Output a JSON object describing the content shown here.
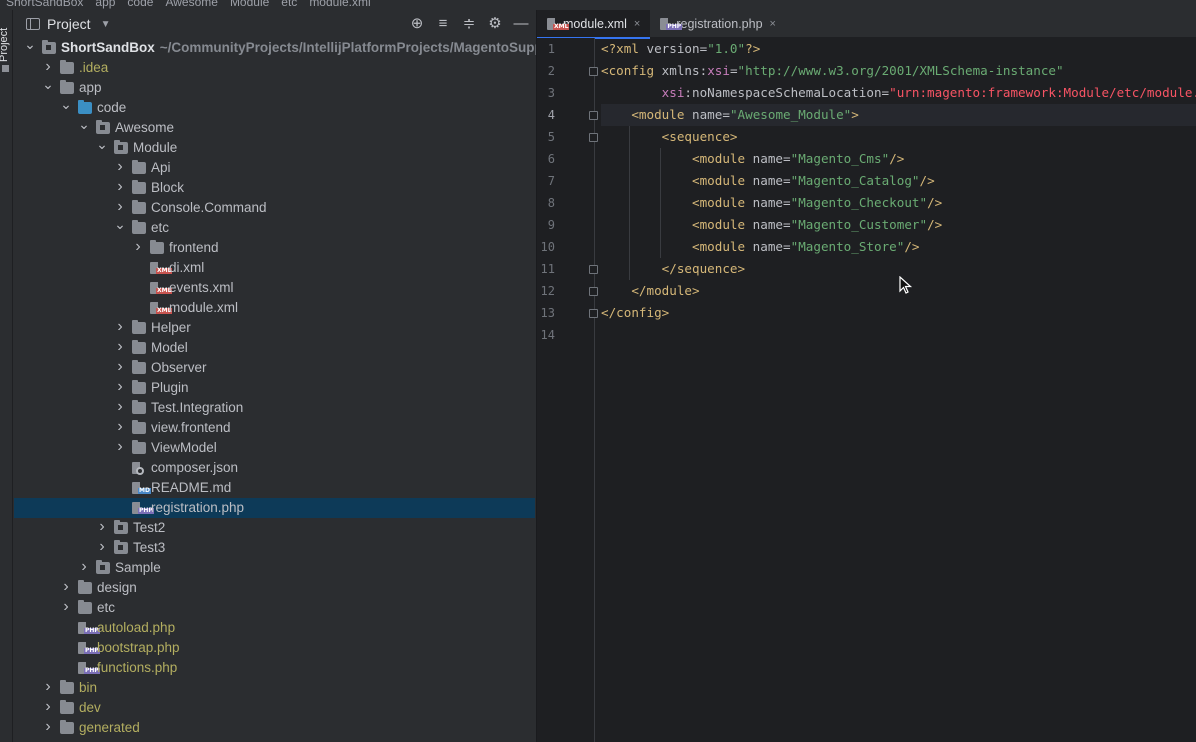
{
  "breadcrumbs": [
    "ShortSandBox",
    "app",
    "code",
    "Awesome",
    "Module",
    "etc",
    "module.xml"
  ],
  "left_strip": {
    "tab_label": "Project"
  },
  "project_panel": {
    "title": "Project",
    "tools": [
      "locate-icon",
      "expand-all-icon",
      "collapse-all-icon",
      "gear-icon",
      "minimize-icon"
    ],
    "tree": [
      {
        "label": "ShortSandBox",
        "path": "~/CommunityProjects/IntellijPlatformProjects/MagentoSupport/",
        "depth": 0,
        "expanded": true,
        "type": "module-folder",
        "bold": true
      },
      {
        "label": ".idea",
        "depth": 1,
        "expanded": false,
        "type": "folder",
        "color": "yellow"
      },
      {
        "label": "app",
        "depth": 1,
        "expanded": true,
        "type": "folder"
      },
      {
        "label": "code",
        "depth": 2,
        "expanded": true,
        "type": "source-folder"
      },
      {
        "label": "Awesome",
        "depth": 3,
        "expanded": true,
        "type": "module-folder"
      },
      {
        "label": "Module",
        "depth": 4,
        "expanded": true,
        "type": "module-folder"
      },
      {
        "label": "Api",
        "depth": 5,
        "expanded": false,
        "type": "folder"
      },
      {
        "label": "Block",
        "depth": 5,
        "expanded": false,
        "type": "folder"
      },
      {
        "label": "Console.Command",
        "depth": 5,
        "expanded": false,
        "type": "folder"
      },
      {
        "label": "etc",
        "depth": 5,
        "expanded": true,
        "type": "folder"
      },
      {
        "label": "frontend",
        "depth": 6,
        "expanded": false,
        "type": "folder"
      },
      {
        "label": "di.xml",
        "depth": 6,
        "type": "xml"
      },
      {
        "label": "events.xml",
        "depth": 6,
        "type": "xml"
      },
      {
        "label": "module.xml",
        "depth": 6,
        "type": "xml"
      },
      {
        "label": "Helper",
        "depth": 5,
        "expanded": false,
        "type": "folder"
      },
      {
        "label": "Model",
        "depth": 5,
        "expanded": false,
        "type": "folder"
      },
      {
        "label": "Observer",
        "depth": 5,
        "expanded": false,
        "type": "folder"
      },
      {
        "label": "Plugin",
        "depth": 5,
        "expanded": false,
        "type": "folder"
      },
      {
        "label": "Test.Integration",
        "depth": 5,
        "expanded": false,
        "type": "folder"
      },
      {
        "label": "view.frontend",
        "depth": 5,
        "expanded": false,
        "type": "folder"
      },
      {
        "label": "ViewModel",
        "depth": 5,
        "expanded": false,
        "type": "folder"
      },
      {
        "label": "composer.json",
        "depth": 5,
        "type": "json"
      },
      {
        "label": "README.md",
        "depth": 5,
        "type": "md"
      },
      {
        "label": "registration.php",
        "depth": 5,
        "type": "php",
        "selected": true
      },
      {
        "label": "Test2",
        "depth": 4,
        "expanded": false,
        "type": "module-folder"
      },
      {
        "label": "Test3",
        "depth": 4,
        "expanded": false,
        "type": "module-folder"
      },
      {
        "label": "Sample",
        "depth": 3,
        "expanded": false,
        "type": "module-folder"
      },
      {
        "label": "design",
        "depth": 2,
        "expanded": false,
        "type": "folder"
      },
      {
        "label": "etc",
        "depth": 2,
        "expanded": false,
        "type": "folder"
      },
      {
        "label": "autoload.php",
        "depth": 2,
        "type": "php",
        "color": "yellow"
      },
      {
        "label": "bootstrap.php",
        "depth": 2,
        "type": "php",
        "color": "yellow"
      },
      {
        "label": "functions.php",
        "depth": 2,
        "type": "php",
        "color": "yellow"
      },
      {
        "label": "bin",
        "depth": 1,
        "expanded": false,
        "type": "folder",
        "color": "yellow"
      },
      {
        "label": "dev",
        "depth": 1,
        "expanded": false,
        "type": "folder",
        "color": "yellow"
      },
      {
        "label": "generated",
        "depth": 1,
        "expanded": false,
        "type": "folder",
        "color": "yellow"
      }
    ]
  },
  "editor": {
    "tabs": [
      {
        "label": "module.xml",
        "type": "xml",
        "active": true,
        "close": "×"
      },
      {
        "label": "registration.php",
        "type": "php",
        "active": false,
        "close": "×"
      }
    ],
    "current_line": 4,
    "lines": [
      {
        "n": "1",
        "indent": 0,
        "tokens": [
          [
            "t-punct",
            "<?"
          ],
          [
            "t-tag",
            "xml "
          ],
          [
            "t-attr",
            "version"
          ],
          [
            "t-attr",
            "="
          ],
          [
            "t-val",
            "\"1.0\""
          ],
          [
            "t-punct",
            "?>"
          ]
        ]
      },
      {
        "n": "2",
        "indent": 0,
        "fold": true,
        "tokens": [
          [
            "t-tag",
            "<config "
          ],
          [
            "t-attr",
            "xmlns"
          ],
          [
            "t-attr",
            ":"
          ],
          [
            "t-ns",
            "xsi"
          ],
          [
            "t-attr",
            "="
          ],
          [
            "t-val",
            "\"http://www.w3.org/2001/XMLSchema-instance\""
          ]
        ]
      },
      {
        "n": "3",
        "indent": 8,
        "tokens": [
          [
            "t-ns",
            "xsi"
          ],
          [
            "t-attr",
            ":noNamespaceSchemaLocation="
          ],
          [
            "t-err",
            "\"urn:magento:framework:Module/etc/module.xsd\""
          ],
          [
            "t-punct",
            ">"
          ]
        ]
      },
      {
        "n": "4",
        "indent": 4,
        "fold": true,
        "bulb": true,
        "tokens": [
          [
            "t-tag",
            "<module "
          ],
          [
            "t-attr",
            "name"
          ],
          [
            "t-attr",
            "="
          ],
          [
            "t-val",
            "\"Awesome_Module\""
          ],
          [
            "t-tag",
            ">"
          ]
        ]
      },
      {
        "n": "5",
        "indent": 8,
        "fold": true,
        "tokens": [
          [
            "t-tag",
            "<sequence>"
          ]
        ]
      },
      {
        "n": "6",
        "indent": 12,
        "tokens": [
          [
            "t-tag",
            "<module "
          ],
          [
            "t-attr",
            "name"
          ],
          [
            "t-attr",
            "="
          ],
          [
            "t-val",
            "\"Magento_Cms\""
          ],
          [
            "t-tag",
            "/>"
          ]
        ]
      },
      {
        "n": "7",
        "indent": 12,
        "tokens": [
          [
            "t-tag",
            "<module "
          ],
          [
            "t-attr",
            "name"
          ],
          [
            "t-attr",
            "="
          ],
          [
            "t-val",
            "\"Magento_Catalog\""
          ],
          [
            "t-tag",
            "/>"
          ]
        ]
      },
      {
        "n": "8",
        "indent": 12,
        "tokens": [
          [
            "t-tag",
            "<module "
          ],
          [
            "t-attr",
            "name"
          ],
          [
            "t-attr",
            "="
          ],
          [
            "t-val",
            "\"Magento_Checkout\""
          ],
          [
            "t-tag",
            "/>"
          ]
        ]
      },
      {
        "n": "9",
        "indent": 12,
        "tokens": [
          [
            "t-tag",
            "<module "
          ],
          [
            "t-attr",
            "name"
          ],
          [
            "t-attr",
            "="
          ],
          [
            "t-val",
            "\"Magento_Customer\""
          ],
          [
            "t-tag",
            "/>"
          ]
        ]
      },
      {
        "n": "10",
        "indent": 12,
        "tokens": [
          [
            "t-tag",
            "<module "
          ],
          [
            "t-attr",
            "name"
          ],
          [
            "t-attr",
            "="
          ],
          [
            "t-val",
            "\"Magento_Store\""
          ],
          [
            "t-tag",
            "/>"
          ]
        ]
      },
      {
        "n": "11",
        "indent": 8,
        "fold": true,
        "tokens": [
          [
            "t-tag",
            "</sequence>"
          ]
        ]
      },
      {
        "n": "12",
        "indent": 4,
        "fold": true,
        "tokens": [
          [
            "t-tag",
            "</module>"
          ]
        ]
      },
      {
        "n": "13",
        "indent": 0,
        "fold": true,
        "tokens": [
          [
            "t-tag",
            "</config>"
          ]
        ]
      },
      {
        "n": "14",
        "indent": 0,
        "tokens": []
      }
    ]
  }
}
